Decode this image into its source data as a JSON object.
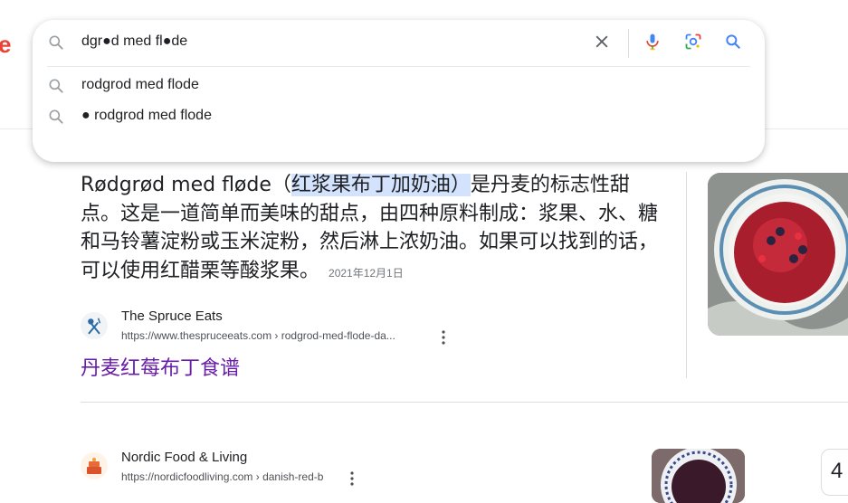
{
  "logo_fragment": "e",
  "search": {
    "query": "dgr●d med fl●de",
    "suggestions": [
      "rodgrod med flode",
      "● rodgrod med flode"
    ]
  },
  "featured_snippet": {
    "text_before": "Rødgrød med fløde（",
    "highlight": "红浆果布丁加奶油）",
    "text_after": "是丹麦的标志性甜点。这是一道简单而美味的甜点，由四种原料制成：浆果、水、糖和马铃薯淀粉或玉米淀粉，然后淋上浓奶油。如果可以找到的话，可以使用红醋栗等酸浆果。",
    "date": "2021年12月1日"
  },
  "results": [
    {
      "site_name": "The Spruce Eats",
      "url": "https://www.thespruceeats.com › rodgrod-med-flode-da...",
      "title": "丹麦红莓布丁食谱"
    },
    {
      "site_name": "Nordic Food & Living",
      "url": "https://nordicfoodliving.com › danish-red-b"
    }
  ],
  "partial_card_text": "4",
  "colors": {
    "link_visited": "#681da8",
    "highlight": "#d3e3fd",
    "logo_red": "#ea4335"
  }
}
